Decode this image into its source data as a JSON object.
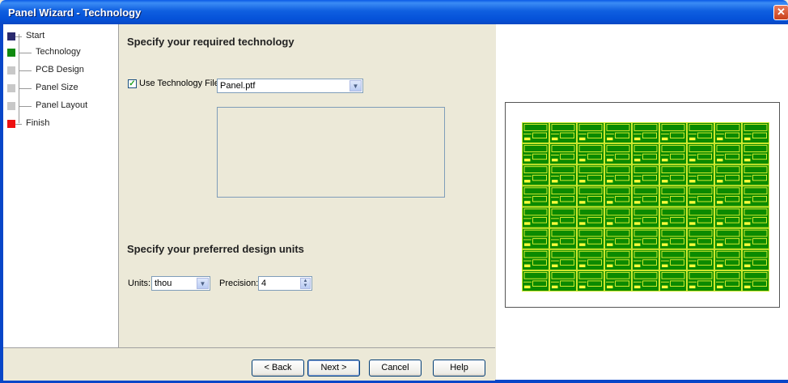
{
  "window": {
    "title": "Panel Wizard - Technology",
    "close_glyph": "✕"
  },
  "nav": {
    "items": [
      {
        "label": "Start",
        "color": "#2a2a6e"
      },
      {
        "label": "Technology",
        "color": "#108a10"
      },
      {
        "label": "PCB Design",
        "color": "#c8c8c8"
      },
      {
        "label": "Panel Size",
        "color": "#c8c8c8"
      },
      {
        "label": "Panel Layout",
        "color": "#c8c8c8"
      },
      {
        "label": "Finish",
        "color": "#ee1111"
      }
    ]
  },
  "main": {
    "technology_heading": "Specify your required technology",
    "use_tech_file_label": "Use Technology File:",
    "use_tech_file_checked": true,
    "tech_file_value": "Panel.ptf",
    "units_heading": "Specify your preferred design units",
    "units_label": "Units:",
    "units_value": "thou",
    "precision_label": "Precision:",
    "precision_value": "4"
  },
  "buttons": {
    "back": "< Back",
    "next": "Next >",
    "cancel": "Cancel",
    "help": "Help"
  },
  "preview": {
    "board_color": "#0b8a00",
    "trace_color": "#ffff3a",
    "columns": 9,
    "rows": 8
  }
}
